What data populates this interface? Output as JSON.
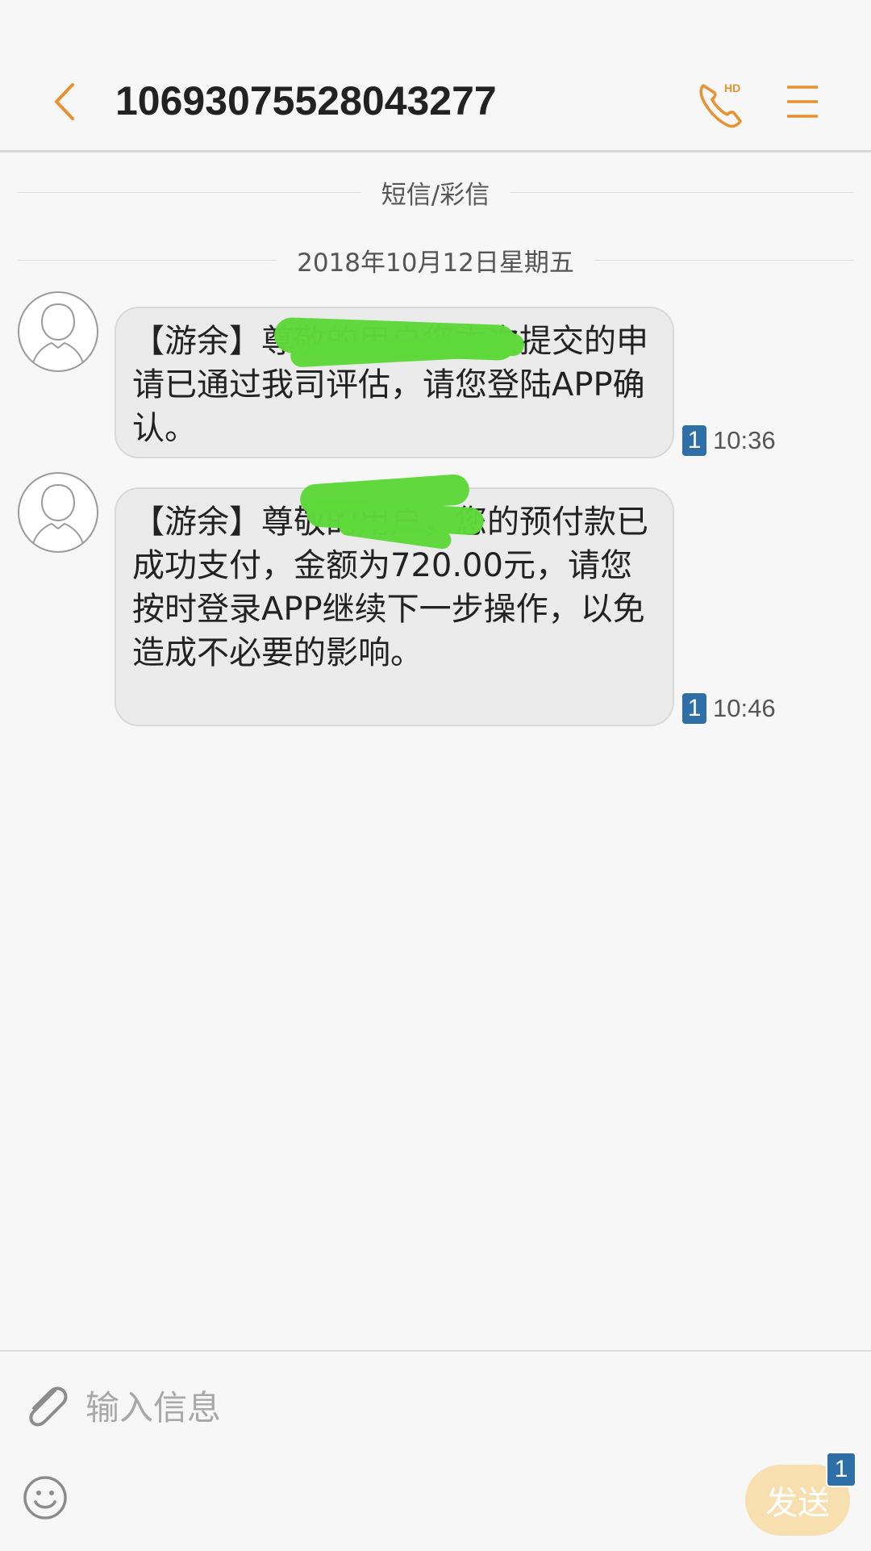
{
  "header": {
    "title": "10693075528043277",
    "call_icon": "hd-call-icon",
    "menu_icon": "menu-icon",
    "back_icon": "chevron-left-icon",
    "call_badge": "HD"
  },
  "thread": {
    "channel_label": "短信/彩信",
    "date_label": "2018年10月12日星期五",
    "messages": [
      {
        "text": "【游余】尊敬的用户您本次提交的申请已通过我司评估，请您登陆APP确认。",
        "sim": "1",
        "time": "10:36"
      },
      {
        "text": "【游余】尊敬的用户，您的预付款已成功支付，金额为720.00元，请您按时登录APP继续下一步操作，以免造成不必要的影响。",
        "sim": "1",
        "time": "10:46"
      }
    ]
  },
  "composer": {
    "placeholder": "输入信息",
    "send_label": "发送",
    "send_sim": "1",
    "attach_icon": "paperclip-icon",
    "emoji_icon": "emoji-icon"
  },
  "colors": {
    "accent": "#e8912e",
    "sim_badge": "#2f6fa8",
    "send_button": "#f8dfb0",
    "redaction": "#5ed83a"
  }
}
